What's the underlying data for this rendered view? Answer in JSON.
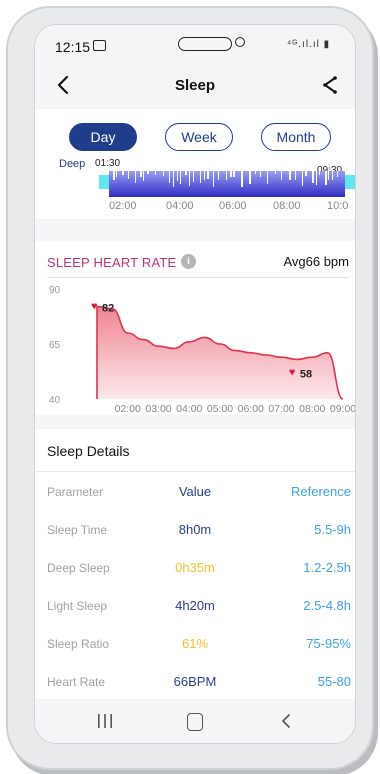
{
  "status": {
    "time": "12:15",
    "signal": "⁴ᴳ.ıl.ıl ▮"
  },
  "header": {
    "title": "Sleep"
  },
  "tabs": [
    {
      "label": "Day",
      "active": true
    },
    {
      "label": "Week",
      "active": false
    },
    {
      "label": "Month",
      "active": false
    }
  ],
  "hypnogram": {
    "stage_label": "Deep",
    "start_time": "01:30",
    "end_time": "09:30",
    "axis_labels": [
      "02:00",
      "04:00",
      "06:00",
      "08:00",
      "10:0"
    ],
    "colors": {
      "deep": "#2f2cc4",
      "light": "#9a9ef5",
      "awake": "#5fe6f0"
    }
  },
  "heart_rate": {
    "title": "SLEEP HEART RATE",
    "avg_label": "Avg66 bpm",
    "max_label": "82",
    "min_label": "58"
  },
  "chart_data": {
    "type": "area",
    "title": "SLEEP HEART RATE",
    "x": [
      "01:30",
      "02:00",
      "02:30",
      "03:00",
      "03:30",
      "04:00",
      "04:30",
      "05:00",
      "05:30",
      "06:00",
      "06:30",
      "07:00",
      "07:30",
      "08:00",
      "08:30",
      "09:00",
      "09:30"
    ],
    "values": [
      82,
      81,
      70,
      67,
      64,
      63,
      66,
      68,
      65,
      62,
      61,
      60,
      59,
      58,
      59,
      61,
      40
    ],
    "x_tick_labels": [
      "02:00",
      "03:00",
      "04:00",
      "05:00",
      "06:00",
      "07:00",
      "08:00",
      "09:00"
    ],
    "y_ticks": [
      40,
      65,
      90
    ],
    "ylim": [
      40,
      90
    ],
    "max": 82,
    "min": 58,
    "line_color": "#e0334f",
    "fill_color": "#f6c3c9"
  },
  "details": {
    "title": "Sleep Details",
    "columns": {
      "parameter": "Parameter",
      "value": "Value",
      "reference": "Reference"
    },
    "rows": [
      {
        "parameter": "Sleep Time",
        "value": "8h0m",
        "reference": "5.5-9h",
        "value_color": "#2b3f8f"
      },
      {
        "parameter": "Deep Sleep",
        "value": "0h35m",
        "reference": "1.2-2.5h",
        "value_color": "#f2c02d"
      },
      {
        "parameter": "Light Sleep",
        "value": "4h20m",
        "reference": "2.5-4.8h",
        "value_color": "#2b3f8f"
      },
      {
        "parameter": "Sleep Ratio",
        "value": "61%",
        "reference": "75-95%",
        "value_color": "#f2c02d"
      },
      {
        "parameter": "Heart Rate",
        "value": "66BPM",
        "reference": "55-80",
        "value_color": "#2b3f8f"
      }
    ]
  },
  "colors": {
    "accent": "#1f3d8a",
    "hr_title": "#c2327a",
    "reference": "#3fa0e6"
  }
}
